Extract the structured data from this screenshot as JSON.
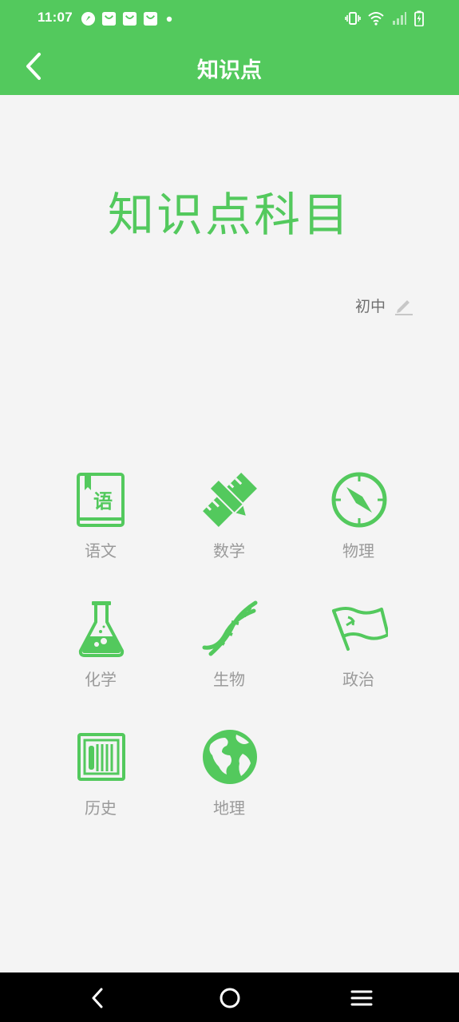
{
  "status_bar": {
    "time": "11:07",
    "icons_left": [
      "location-icon",
      "notification-icon",
      "notification-icon",
      "notification-icon",
      "dot-icon"
    ],
    "icons_right": [
      "vibrate-icon",
      "wifi-icon",
      "signal-icon",
      "battery-charging-icon"
    ]
  },
  "app_bar": {
    "title": "知识点",
    "back_icon": "back-arrow-icon"
  },
  "hero": {
    "title": "知识点科目"
  },
  "grade": {
    "label": "初中",
    "edit_icon": "pencil-icon"
  },
  "subjects": [
    {
      "label": "语文",
      "icon": "book-icon"
    },
    {
      "label": "数学",
      "icon": "pencil-ruler-icon"
    },
    {
      "label": "物理",
      "icon": "compass-icon"
    },
    {
      "label": "化学",
      "icon": "flask-icon"
    },
    {
      "label": "生物",
      "icon": "dna-icon"
    },
    {
      "label": "政治",
      "icon": "flag-icon"
    },
    {
      "label": "历史",
      "icon": "bamboo-scroll-icon"
    },
    {
      "label": "地理",
      "icon": "globe-icon"
    }
  ],
  "icon_glyph": {
    "book": "语"
  },
  "colors": {
    "primary": "#53c95d",
    "background": "#f4f4f4",
    "label_gray": "#9a9a9a",
    "nav_bar": "#000000"
  },
  "nav_bar": {
    "buttons": [
      "nav-back-icon",
      "nav-home-icon",
      "nav-menu-icon"
    ]
  }
}
